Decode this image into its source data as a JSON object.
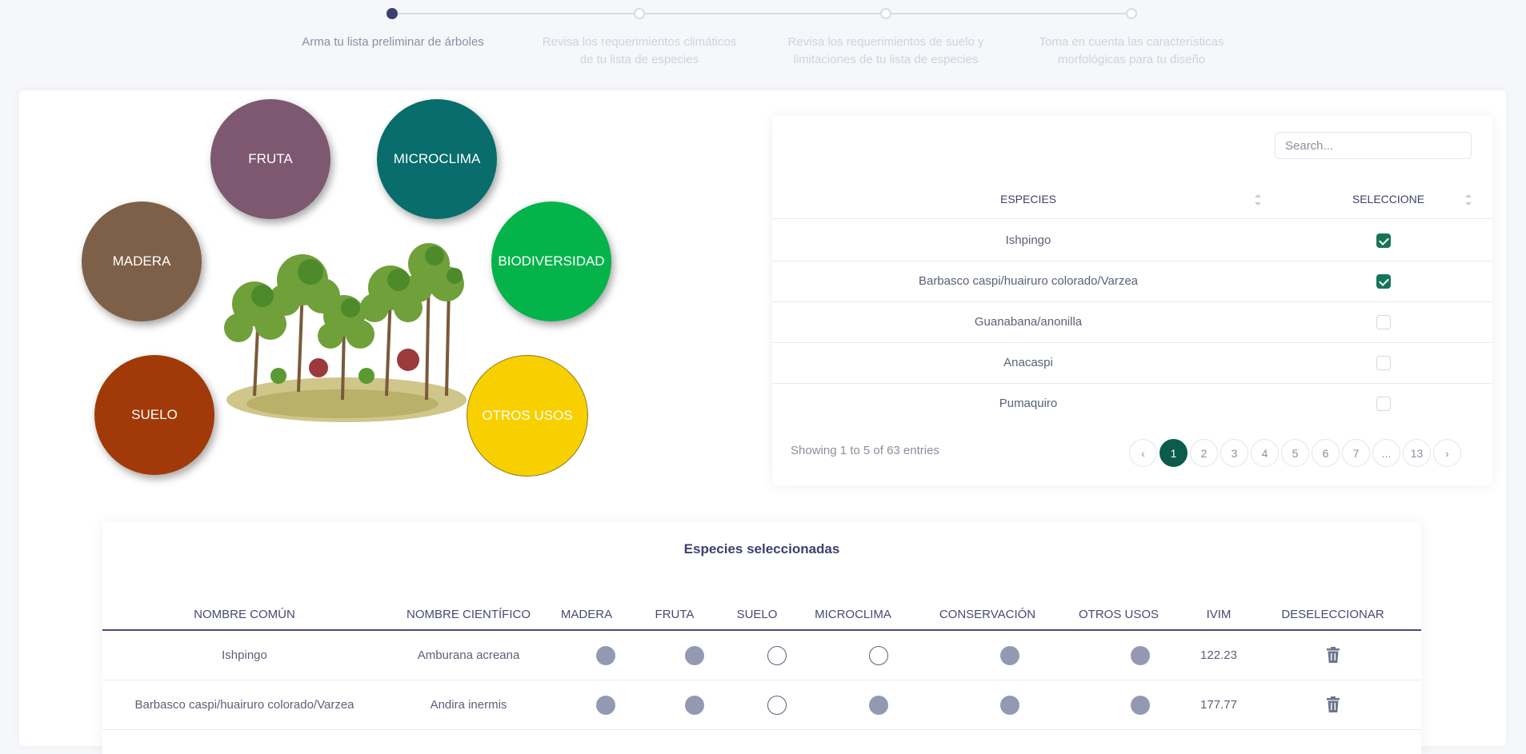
{
  "stepper": {
    "steps": [
      {
        "label": "Arma tu lista preliminar de árboles"
      },
      {
        "label": "Revisa los requerimientos climáticos de tu lista de especies"
      },
      {
        "label": "Revisa los requerimientos de suelo y limitaciones de tu lista de especies"
      },
      {
        "label": "Toma en cuenta las características morfológicas para tu diseño"
      }
    ],
    "active_step": 1
  },
  "categories": {
    "fruta": "FRUTA",
    "microclima": "MICROCLIMA",
    "madera": "MADERA",
    "biodiversidad": "BIODIVERSIDAD",
    "suelo": "SUELO",
    "otros_usos": "OTROS USOS",
    "colors": {
      "fruta": "#7e5870",
      "microclima": "#086d6c",
      "madera": "#7e6048",
      "biodiversidad": "#05b34b",
      "suelo": "#a13a08",
      "otros_usos": "#f8d000"
    }
  },
  "species_table": {
    "search_placeholder": "Search...",
    "headers": {
      "species": "ESPECIES",
      "select": "SELECCIONE"
    },
    "rows": [
      {
        "name": "Ishpingo",
        "selected": true
      },
      {
        "name": "Barbasco caspi/huairuro colorado/Varzea",
        "selected": true
      },
      {
        "name": "Guanabana/anonilla",
        "selected": false
      },
      {
        "name": "Anacaspi",
        "selected": false
      },
      {
        "name": "Pumaquiro",
        "selected": false
      }
    ],
    "showing": "Showing 1 to 5 of 63 entries",
    "pagination": {
      "prev": "‹",
      "pages": [
        "1",
        "2",
        "3",
        "4",
        "5",
        "6",
        "7",
        "...",
        "13"
      ],
      "next": "›",
      "active": "1"
    }
  },
  "selected_species": {
    "title": "Especies seleccionadas",
    "headers": {
      "common": "NOMBRE COMÚN",
      "scientific": "NOMBRE CIENTÍFICO",
      "madera": "MADERA",
      "fruta": "FRUTA",
      "suelo": "SUELO",
      "microclima": "MICROCLIMA",
      "conservacion": "CONSERVACIÓN",
      "otros": "OTROS USOS",
      "ivim": "IVIM",
      "deselect": "DESELECCIONAR"
    },
    "rows": [
      {
        "common": "Ishpingo",
        "scientific": "Amburana acreana",
        "madera": true,
        "fruta": true,
        "suelo": false,
        "microclima": false,
        "conservacion": true,
        "otros": true,
        "ivim": "122.23"
      },
      {
        "common": "Barbasco caspi/huairuro colorado/Varzea",
        "scientific": "Andira inermis",
        "madera": true,
        "fruta": true,
        "suelo": false,
        "microclima": true,
        "conservacion": true,
        "otros": true,
        "ivim": "177.77"
      }
    ]
  }
}
